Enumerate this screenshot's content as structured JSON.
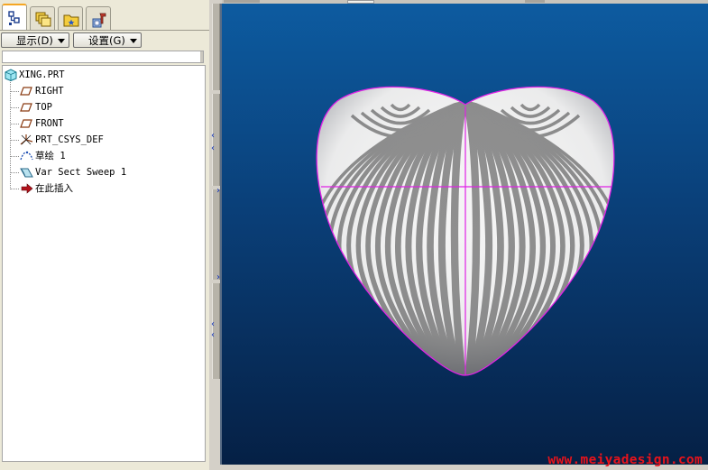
{
  "tabs": [
    {
      "icon": "model-tree-icon",
      "active": true
    },
    {
      "icon": "layers-icon",
      "active": false
    },
    {
      "icon": "folder-star-icon",
      "active": false
    },
    {
      "icon": "tools-icon",
      "active": false
    }
  ],
  "toolbar": {
    "display_label": "显示(D)",
    "settings_label": "设置(G)"
  },
  "tree": {
    "root": {
      "label": "XING.PRT",
      "icon": "part-icon"
    },
    "items": [
      {
        "label": "RIGHT",
        "icon": "datum-plane-icon"
      },
      {
        "label": "TOP",
        "icon": "datum-plane-icon"
      },
      {
        "label": "FRONT",
        "icon": "datum-plane-icon"
      },
      {
        "label": "PRT_CSYS_DEF",
        "icon": "coordinate-system-icon"
      },
      {
        "label": "草绘 1",
        "icon": "sketch-icon"
      },
      {
        "label": "Var Sect Sweep 1",
        "icon": "sweep-icon"
      },
      {
        "label": "在此插入",
        "icon": "insert-here-arrow-icon"
      }
    ]
  },
  "viewport": {
    "model_outline_color": "#e021e6",
    "background_top": "#0d5ba0",
    "background_bottom": "#052045"
  },
  "watermark": "www.meiyadesign.com"
}
